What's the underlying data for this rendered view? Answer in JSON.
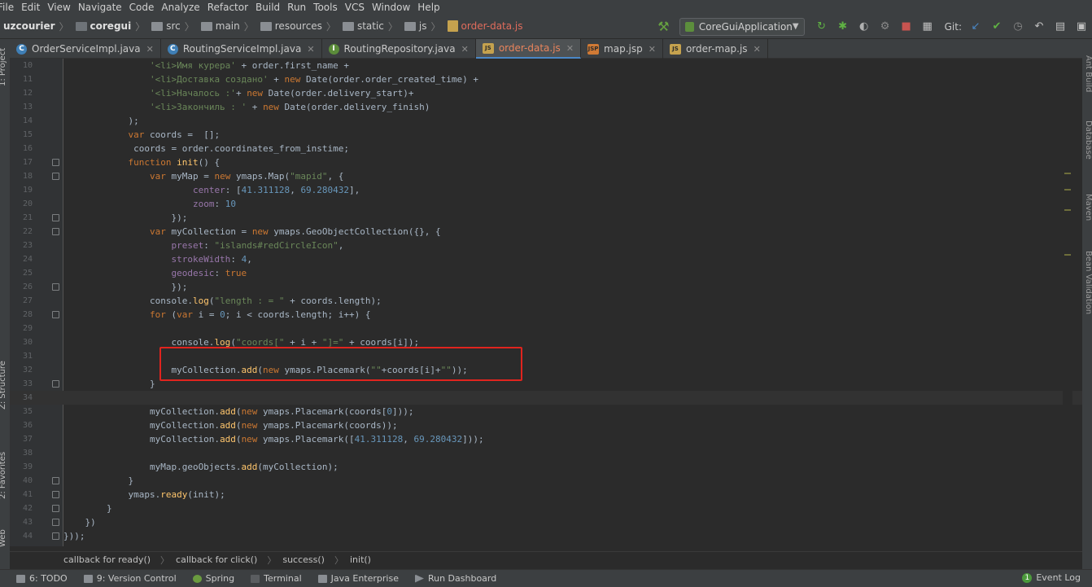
{
  "menu": [
    "File",
    "Edit",
    "View",
    "Navigate",
    "Code",
    "Analyze",
    "Refactor",
    "Build",
    "Run",
    "Tools",
    "VCS",
    "Window",
    "Help"
  ],
  "breadcrumbs": [
    "uzcourier",
    "coregui",
    "src",
    "main",
    "resources",
    "static",
    "js",
    "order-data.js"
  ],
  "run_config": "CoreGuiApplication",
  "git_label": "Git:",
  "tabs": [
    {
      "label": "OrderServiceImpl.java",
      "icon": "class-icon"
    },
    {
      "label": "RoutingServiceImpl.java",
      "icon": "class-icon"
    },
    {
      "label": "RoutingRepository.java",
      "icon": "interface-icon"
    },
    {
      "label": "order-data.js",
      "icon": "js-file-icon",
      "active": true
    },
    {
      "label": "map.jsp",
      "icon": "jsp-file-icon"
    },
    {
      "label": "order-map.js",
      "icon": "js-file-icon"
    }
  ],
  "left_tools": [
    "1: Project",
    "Z: Structure",
    "2: Favorites",
    "Web"
  ],
  "right_tools": [
    "Ant Build",
    "Database",
    "Maven",
    "Bean Validation"
  ],
  "editor": {
    "line_numbers": [
      "10",
      "11",
      "12",
      "13",
      "14",
      "15",
      "16",
      "17",
      "18",
      "19",
      "20",
      "21",
      "22",
      "23",
      "24",
      "25",
      "26",
      "27",
      "28",
      "29",
      "30",
      "31",
      "32",
      "33",
      "34",
      "35",
      "36",
      "37",
      "38",
      "39",
      "40",
      "41",
      "42",
      "43",
      "44"
    ],
    "lines": [
      "                '<li>Имя курера' + order.first_name +",
      "                '<li>Доставка создано' + new Date(order.order_created_time) +",
      "                '<li>Началось :'+ new Date(order.delivery_start)+",
      "                '<li>Закончиль : ' + new Date(order.delivery_finish)",
      "            );",
      "            var coords =  [];",
      "             coords = order.coordinates_from_instime;",
      "            function init() {",
      "                var myMap = new ymaps.Map(\"mapid\", {",
      "                        center: [41.311128, 69.280432],",
      "                        zoom: 10",
      "                    });",
      "                var myCollection = new ymaps.GeoObjectCollection({}, {",
      "                    preset: \"islands#redCircleIcon\",",
      "                    strokeWidth: 4,",
      "                    geodesic: true",
      "                    });",
      "                console.log(\"length : = \" + coords.length);",
      "                for (var i = 0; i < coords.length; i++) {",
      "",
      "                    console.log(\"coords[\" + i + \"]=\" + coords[i]);",
      "",
      "                    myCollection.add(new ymaps.Placemark(\"\"+coords[i]+\"\"));",
      "                }",
      "",
      "                myCollection.add(new ymaps.Placemark(coords[0]));",
      "                myCollection.add(new ymaps.Placemark(coords));",
      "                myCollection.add(new ymaps.Placemark([41.311128, 69.280432]));",
      "",
      "                myMap.geoObjects.add(myCollection);",
      "            }",
      "            ymaps.ready(init);",
      "        }",
      "    })",
      "}));"
    ],
    "current_line": "34"
  },
  "code_crumbs": [
    "callback for ready()",
    "callback for click()",
    "success()",
    "init()"
  ],
  "bottom_tools": [
    {
      "label": "6: TODO"
    },
    {
      "label": "9: Version Control"
    },
    {
      "label": "Spring"
    },
    {
      "label": "Terminal"
    },
    {
      "label": "Java Enterprise"
    },
    {
      "label": "Run Dashboard"
    }
  ],
  "event_log": "Event Log",
  "colors": {
    "accent": "#4a88c7",
    "highlight_box": "#e0241e",
    "keyword": "#cc7832",
    "string": "#6a8759",
    "number": "#6897bb"
  }
}
